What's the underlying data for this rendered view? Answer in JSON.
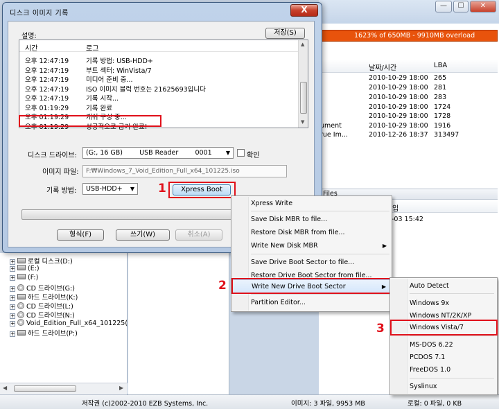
{
  "dialog": {
    "title": "디스크 이미지 기록",
    "close_label": "X",
    "log_label": "설명:",
    "save_button": "저장(S)",
    "log_headers": {
      "time": "시간",
      "log": "로그"
    },
    "log_rows": [
      {
        "time": "오후 12:47:19",
        "msg": "기록 방법: USB-HDD+"
      },
      {
        "time": "오후 12:47:19",
        "msg": "부트 섹터: WinVista/7"
      },
      {
        "time": "오후 12:47:19",
        "msg": "미디어 준비 중..."
      },
      {
        "time": "오후 12:47:19",
        "msg": "ISO 이미지 블럭 번호는 21625693입니다"
      },
      {
        "time": "오후 12:47:19",
        "msg": "기록 시작..."
      },
      {
        "time": "오후 01:19:29",
        "msg": "기록 완료"
      },
      {
        "time": "오후 01:19:29",
        "msg": "캐쉬 구성 중..."
      },
      {
        "time": "오후 01:19:29",
        "msg": "성공적으로 굽기 완료!"
      }
    ],
    "drive_label": "디스크 드라이브:",
    "drive_value": "(G:, 16 GB)        USB Reader        0001",
    "verify_label": "확인",
    "image_label": "이미지 파일:",
    "image_value": "F:₩Windows_7_Void_Edition_Full_x64_101225.iso",
    "method_label": "기록 방법:",
    "method_value": "USB-HDD+",
    "xpress_button": "Xpress Boot",
    "format_button": "형식(F)",
    "write_button": "쓰기(W)",
    "cancel_button": "취소(A)"
  },
  "steps": {
    "one": "1",
    "two": "2",
    "three": "3"
  },
  "menu": {
    "items": [
      {
        "label": "Xpress Write",
        "sub": ""
      },
      {
        "label": "Save Disk MBR to file...",
        "sub": ""
      },
      {
        "label": "Restore Disk MBR from file...",
        "sub": ""
      },
      {
        "label": "Write New Disk MBR",
        "sub": "▶"
      },
      {
        "label": "Save Drive Boot Sector to file...",
        "sub": ""
      },
      {
        "label": "Restore Drive Boot Sector from file...",
        "sub": ""
      },
      {
        "label": "Write New Drive Boot Sector",
        "sub": "▶"
      },
      {
        "label": "Partition Editor...",
        "sub": ""
      }
    ]
  },
  "submenu": {
    "items": [
      {
        "label": "Auto Detect"
      },
      {
        "label": "Windows 9x"
      },
      {
        "label": "Windows NT/2K/XP"
      },
      {
        "label": "Windows Vista/7"
      },
      {
        "label": "MS-DOS 6.22"
      },
      {
        "label": "PCDOS 7.1"
      },
      {
        "label": "FreeDOS 1.0"
      },
      {
        "label": "Syslinux"
      }
    ]
  },
  "background": {
    "progress_text": "1623% of 650MB - 9910MB overload",
    "file_headers": {
      "date": "날짜/시간",
      "lba": "LBA"
    },
    "file_rows": [
      {
        "name": "",
        "date": "2010-10-29 18:00",
        "lba": "265"
      },
      {
        "name": "",
        "date": "2010-10-29 18:00",
        "lba": "281"
      },
      {
        "name": "",
        "date": "2010-10-29 18:00",
        "lba": "283"
      },
      {
        "name": "",
        "date": "2010-10-29 18:00",
        "lba": "1724"
      },
      {
        "name": "",
        "date": "2010-10-29 18:00",
        "lba": "1728"
      },
      {
        "name": "ument",
        "date": "2010-10-29 18:00",
        "lba": "1916"
      },
      {
        "name": "rue Im...",
        "date": "2010-12-26 18:37",
        "lba": "313497"
      }
    ],
    "files_label": "Files",
    "files_hdr": "입",
    "files_row_date": "-03 15:42",
    "tree": [
      {
        "label": "로컬 디스크(D:)",
        "kind": "drv"
      },
      {
        "label": "(E:)",
        "kind": "drv"
      },
      {
        "label": "(F:)",
        "kind": "drv"
      },
      {
        "label": "CD 드라이브(G:)",
        "kind": "cd"
      },
      {
        "label": "하드 드라이브(K:)",
        "kind": "drv"
      },
      {
        "label": "CD 드라이브(L:)",
        "kind": "cd"
      },
      {
        "label": "CD 드라이브(N:)",
        "kind": "cd"
      },
      {
        "label": "Void_Edition_Full_x64_101225(",
        "kind": "cd"
      },
      {
        "label": "하드 드라이브(P:)",
        "kind": "drv"
      }
    ],
    "status": {
      "copyright": "저작권 (c)2002-2010 EZB Systems, Inc.",
      "image": "이미지: 3 파일, 9953 MB",
      "local": "로컬: 0 파일, 0 KB"
    }
  },
  "window_buttons": {
    "minimize": "—",
    "maximize": "☐",
    "close": "✕"
  }
}
